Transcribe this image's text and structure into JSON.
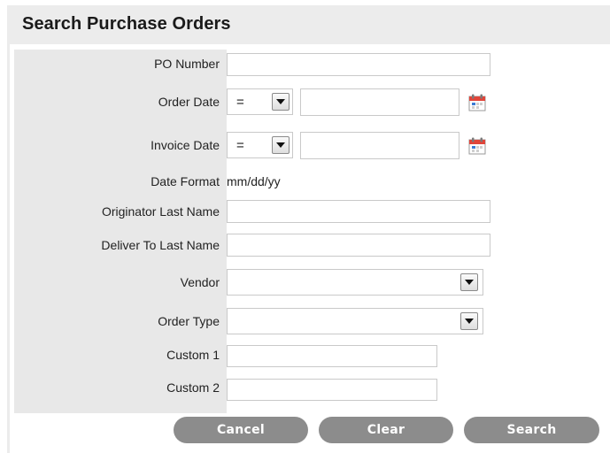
{
  "title": "Search Purchase Orders",
  "fields": {
    "po_number": {
      "label": "PO Number",
      "value": ""
    },
    "order_date": {
      "label": "Order Date",
      "operator": "=",
      "value": ""
    },
    "invoice_date": {
      "label": "Invoice Date",
      "operator": "=",
      "value": ""
    },
    "date_format": {
      "label": "Date Format",
      "value": "mm/dd/yy"
    },
    "originator_last_name": {
      "label": "Originator Last Name",
      "value": ""
    },
    "deliver_to_last_name": {
      "label": "Deliver To Last Name",
      "value": ""
    },
    "vendor": {
      "label": "Vendor",
      "value": ""
    },
    "order_type": {
      "label": "Order Type",
      "value": ""
    },
    "custom1": {
      "label": "Custom 1",
      "value": ""
    },
    "custom2": {
      "label": "Custom 2",
      "value": ""
    }
  },
  "buttons": {
    "cancel": "Cancel",
    "clear": "Clear",
    "search": "Search"
  },
  "icons": {
    "calendar": "calendar-icon",
    "dropdown": "chevron-down-icon"
  },
  "colors": {
    "header_bg": "#ececec",
    "label_col_bg": "#e8e8e8",
    "button_bg": "#8c8c8c"
  }
}
